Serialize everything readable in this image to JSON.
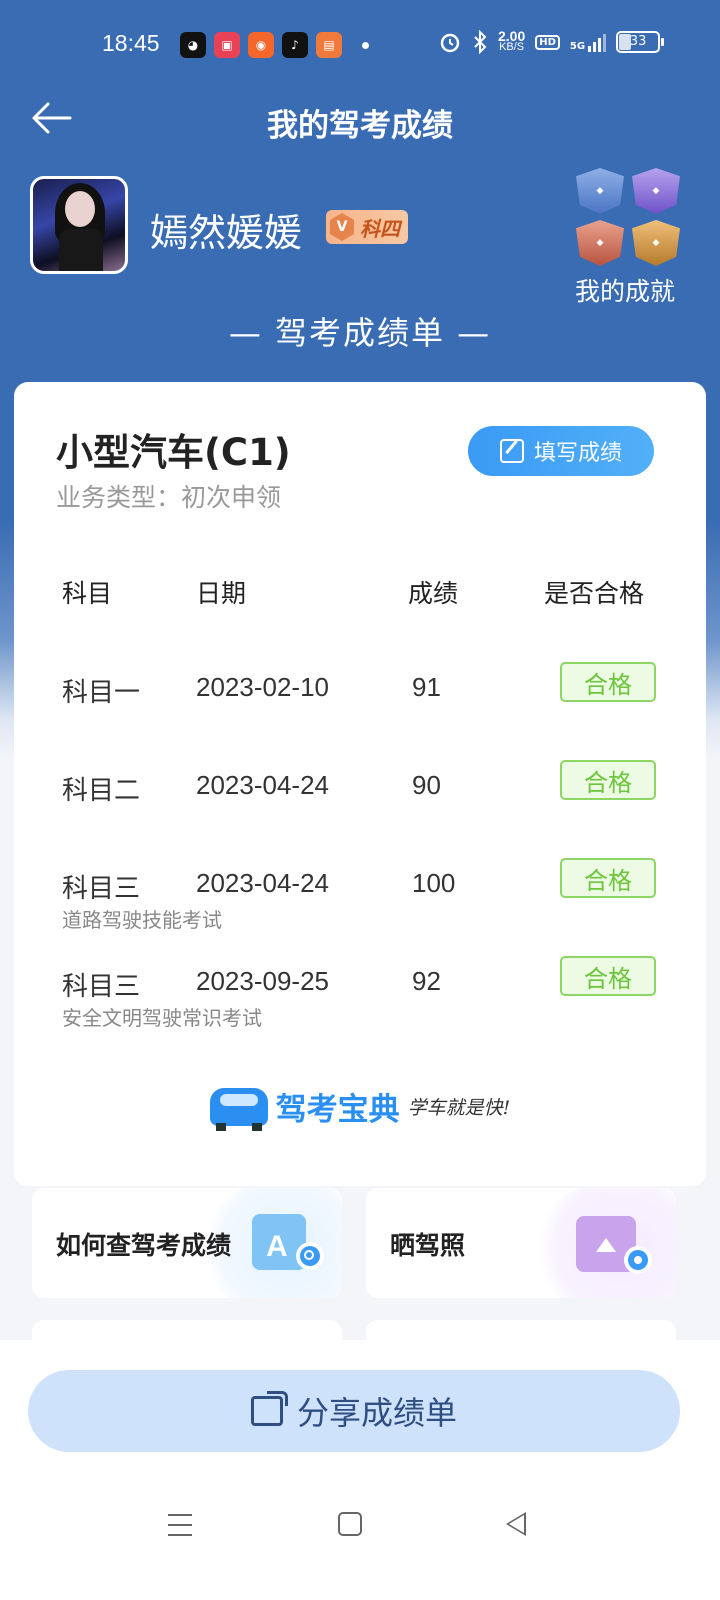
{
  "status_bar": {
    "time": "18:45",
    "net_speed_value": "2.00",
    "net_speed_unit": "KB/S",
    "hd": "HD",
    "network": "5G",
    "battery": "33"
  },
  "nav": {
    "title": "我的驾考成绩"
  },
  "profile": {
    "username": "嫣然媛媛",
    "level_badge": "科四",
    "achievements_label": "我的成就"
  },
  "section_title": "— 驾考成绩单 —",
  "card": {
    "vehicle_type": "小型汽车(C1)",
    "business_type": "业务类型：初次申领",
    "fill_button": "填写成绩",
    "headers": [
      "科目",
      "日期",
      "成绩",
      "是否合格"
    ],
    "rows": [
      {
        "subject": "科目一",
        "date": "2023-02-10",
        "score": "91",
        "status": "合格",
        "note": ""
      },
      {
        "subject": "科目二",
        "date": "2023-04-24",
        "score": "90",
        "status": "合格",
        "note": ""
      },
      {
        "subject": "科目三",
        "date": "2023-04-24",
        "score": "100",
        "status": "合格",
        "note": "道路驾驶技能考试"
      },
      {
        "subject": "科目三",
        "date": "2023-09-25",
        "score": "92",
        "status": "合格",
        "note": "安全文明驾驶常识考试"
      }
    ],
    "brand_name": "驾考宝典",
    "brand_slogan": "学车就是快!"
  },
  "tiles": [
    {
      "label": "如何查驾考成绩",
      "icon": "search-doc-icon"
    },
    {
      "label": "晒驾照",
      "icon": "photo-icon"
    }
  ],
  "share_button": "分享成绩单",
  "colors": {
    "header_blue": "#3a6cb3",
    "accent_blue": "#3a9af5",
    "pass_green": "#6cc63b",
    "share_bg": "#cfe2fb"
  }
}
